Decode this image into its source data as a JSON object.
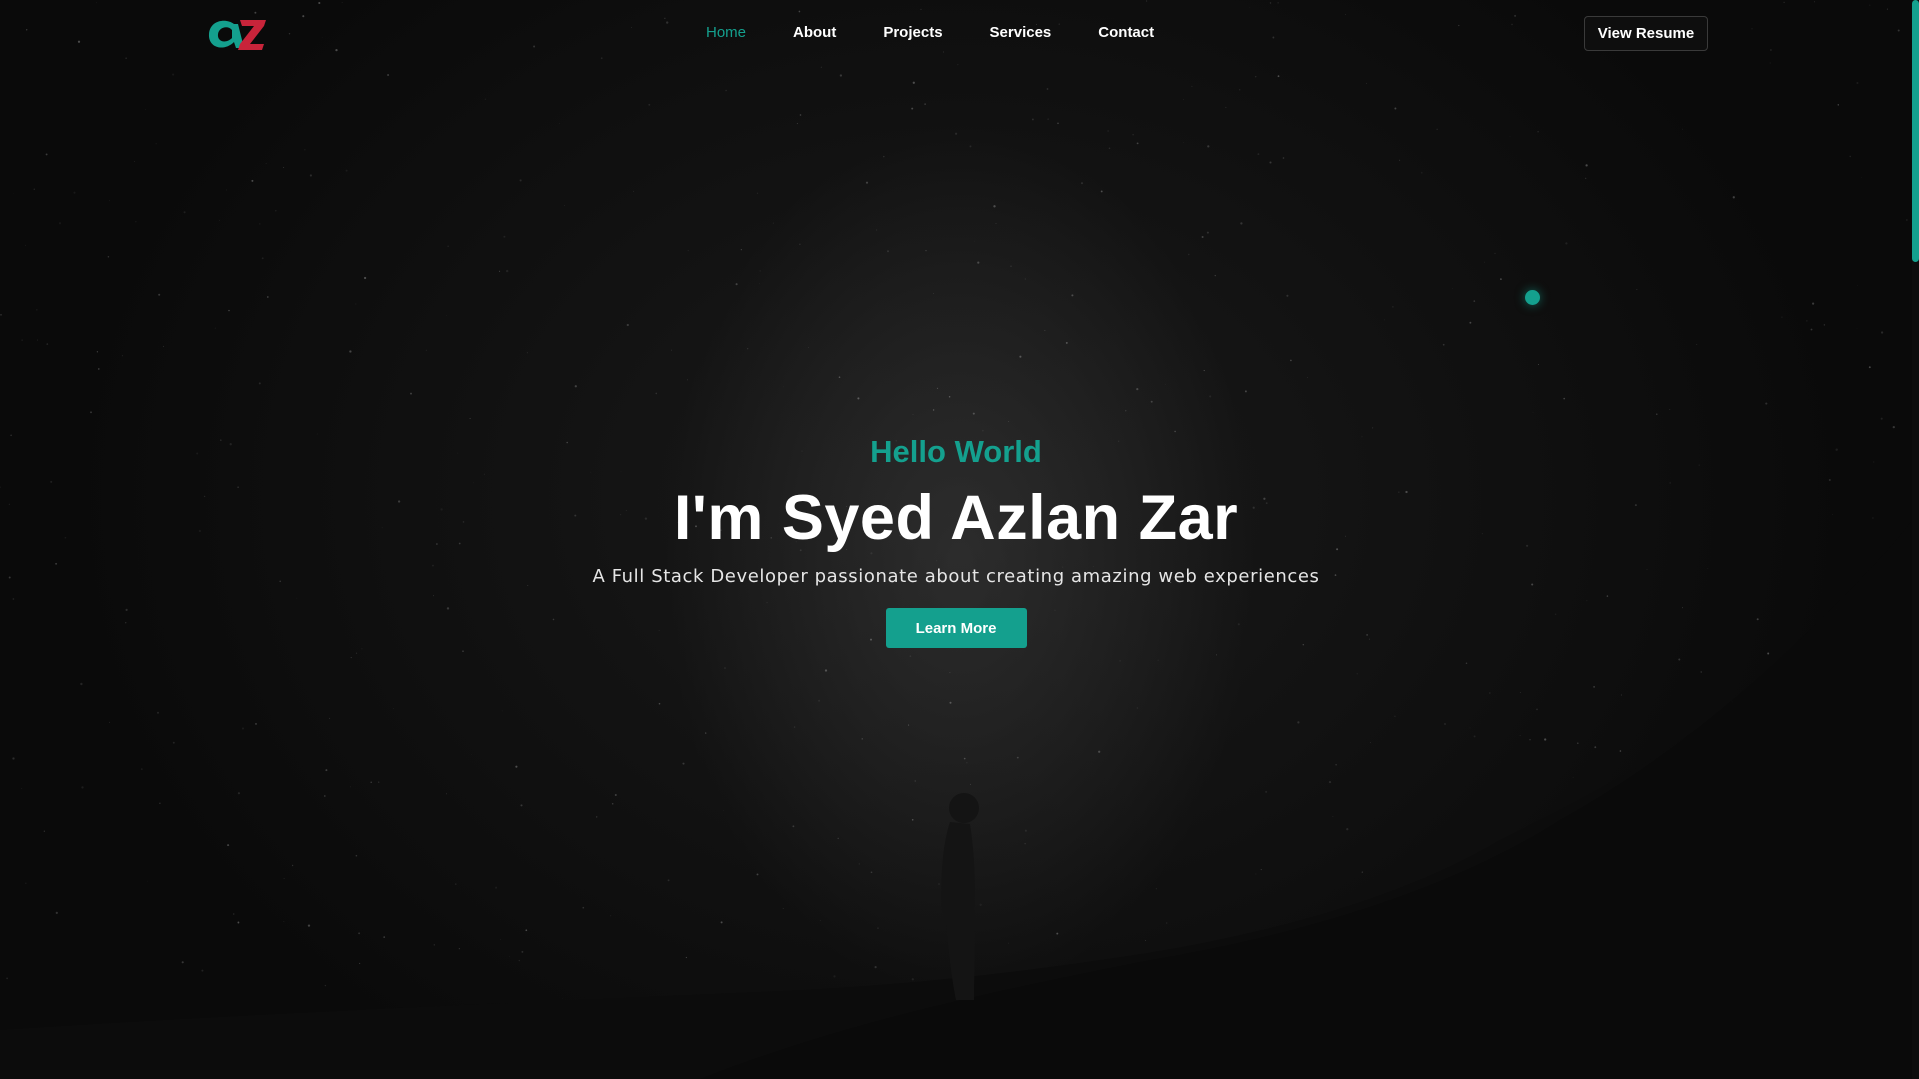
{
  "header": {
    "logo_text": "AZ",
    "nav": [
      {
        "label": "Home",
        "active": true
      },
      {
        "label": "About",
        "active": false
      },
      {
        "label": "Projects",
        "active": false
      },
      {
        "label": "Services",
        "active": false
      },
      {
        "label": "Contact",
        "active": false
      }
    ],
    "resume_label": "View Resume"
  },
  "hero": {
    "greeting": "Hello World",
    "name": "I'm Syed Azlan Zar",
    "tagline": "A Full Stack Developer passionate about creating amazing web experiences",
    "cta_label": "Learn More"
  },
  "colors": {
    "accent": "#14a08e",
    "logo_red": "#c8243a",
    "background": "#0b0b0b",
    "text": "#ffffff"
  },
  "icons": {
    "logo": "az-monogram-logo",
    "floating_dot": "accent-dot"
  }
}
